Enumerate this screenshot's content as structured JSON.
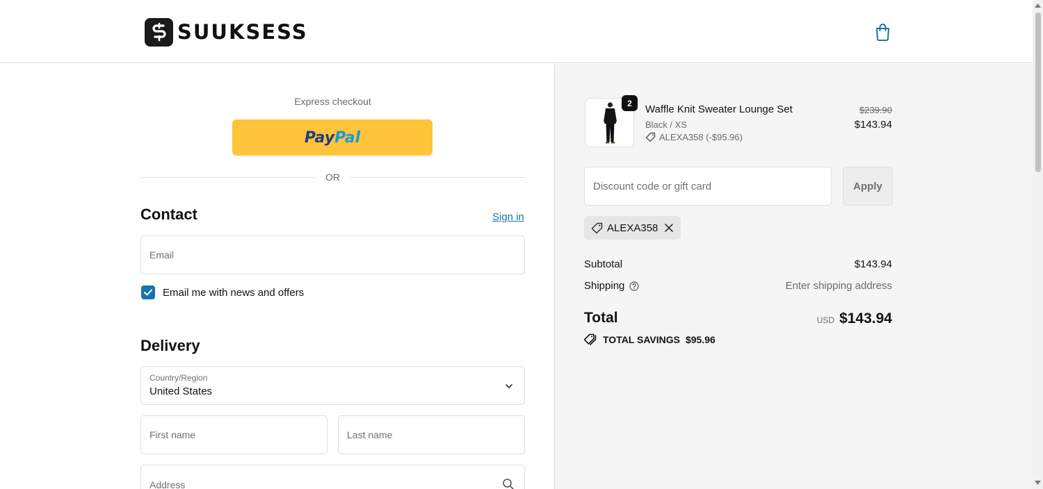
{
  "header": {
    "brand": "SUUKSESS",
    "cart_icon": "shopping-bag-icon"
  },
  "express": {
    "label": "Express checkout",
    "paypal_pay": "Pay",
    "paypal_pal": "Pal",
    "or_text": "OR"
  },
  "contact": {
    "title": "Contact",
    "sign_in": "Sign in",
    "email_placeholder": "Email",
    "newsletter_label": "Email me with news and offers",
    "newsletter_checked": true
  },
  "delivery": {
    "title": "Delivery",
    "country_label": "Country/Region",
    "country_value": "United States",
    "first_name_placeholder": "First name",
    "last_name_placeholder": "Last name",
    "address_placeholder": "Address"
  },
  "summary": {
    "product": {
      "name": "Waffle Knit Sweater Lounge Set",
      "variant": "Black / XS",
      "discount_code": "ALEXA358 (-$95.96)",
      "quantity": "2",
      "original_price": "$239.90",
      "price": "$143.94"
    },
    "discount_placeholder": "Discount code or gift card",
    "apply_label": "Apply",
    "applied_code": "ALEXA358",
    "subtotal_label": "Subtotal",
    "subtotal_value": "$143.94",
    "shipping_label": "Shipping",
    "shipping_value": "Enter shipping address",
    "total_label": "Total",
    "total_currency": "USD",
    "total_value": "$143.94",
    "savings_label": "TOTAL SAVINGS",
    "savings_value": "$95.96"
  },
  "colors": {
    "accent": "#1773b0",
    "paypal_yellow": "#ffc439",
    "summary_bg": "#f5f5f5"
  }
}
